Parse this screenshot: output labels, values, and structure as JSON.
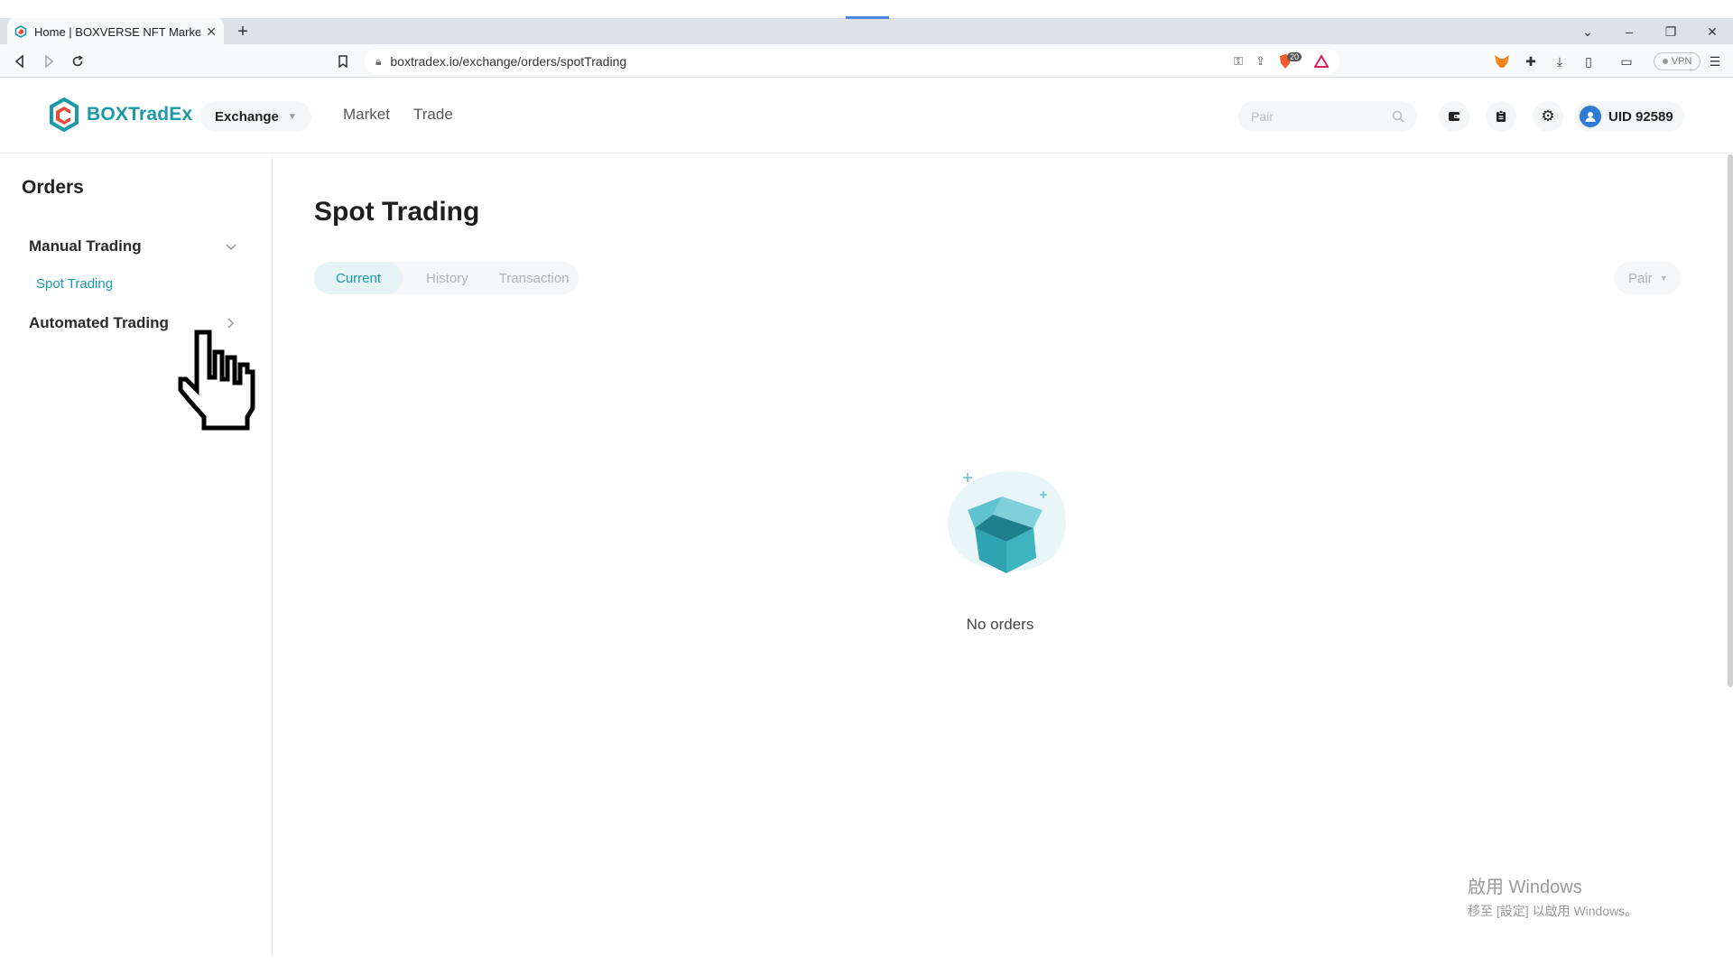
{
  "browser": {
    "tab_title": "Home | BOXVERSE NFT Marketp",
    "new_tab_label": "+",
    "url": "boxtradex.io/exchange/orders/spotTrading",
    "vpn_label": "VPN",
    "brave_badge": "20"
  },
  "header": {
    "brand": "BOXTradEx",
    "exchange_label": "Exchange",
    "nav": {
      "market": "Market",
      "trade": "Trade"
    },
    "search_placeholder": "Pair",
    "user_label": "UID 92589"
  },
  "sidebar": {
    "title": "Orders",
    "groups": [
      {
        "label": "Manual Trading",
        "items": [
          {
            "label": "Spot Trading"
          }
        ]
      },
      {
        "label": "Automated Trading"
      }
    ]
  },
  "main": {
    "title": "Spot Trading",
    "tabs": [
      {
        "label": "Current"
      },
      {
        "label": "History"
      },
      {
        "label": "Transaction"
      }
    ],
    "active_tab": "Current",
    "pair_filter": "Pair",
    "empty_text": "No orders"
  },
  "watermark": {
    "line1": "啟用 Windows",
    "line2": "移至 [設定] 以啟用 Windows。"
  },
  "colors": {
    "accent": "#1a9aa8",
    "brand_red": "#e94b3c"
  }
}
